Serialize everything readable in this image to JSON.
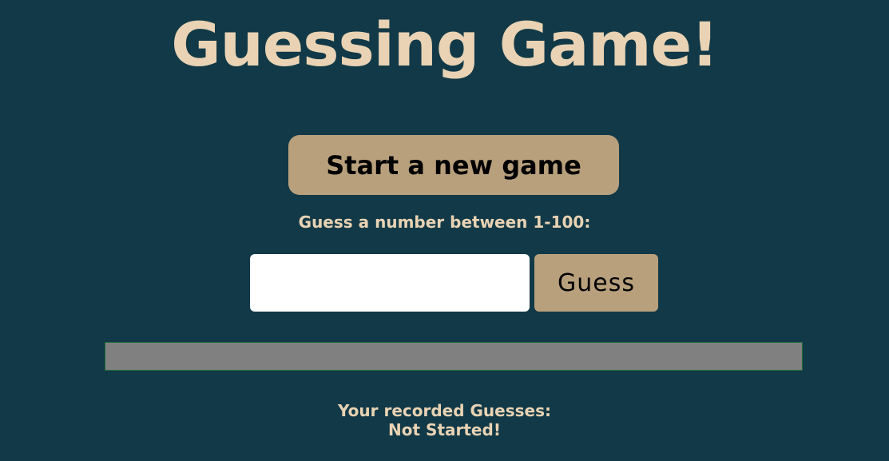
{
  "title": "Guessing Game!",
  "new_game_button": "Start a new game",
  "prompt": "Guess a number between 1-100:",
  "guess_input": {
    "value": "",
    "placeholder": ""
  },
  "guess_button": "Guess",
  "feedback": "",
  "recorded": {
    "label": "Your recorded Guesses:",
    "status": "Not Started!"
  },
  "colors": {
    "background": "#123947",
    "accent_text": "#e9d3b4",
    "button": "#b8a07d",
    "feedback_bar": "#808080"
  }
}
